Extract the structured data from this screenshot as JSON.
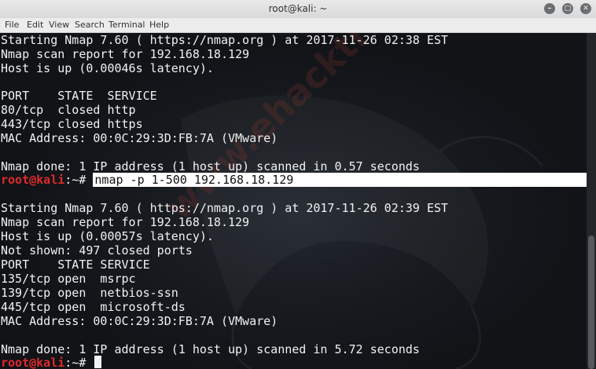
{
  "window": {
    "title": "root@kali: ~",
    "controls": [
      "minimize",
      "maximize",
      "close"
    ]
  },
  "menu": [
    "File",
    "Edit",
    "View",
    "Search",
    "Terminal",
    "Help"
  ],
  "watermark": "www.ehacktrick.in",
  "terminal": {
    "prompt_user": "root@kali",
    "prompt_rest": ":~#",
    "lines": [
      "Starting Nmap 7.60 ( https://nmap.org ) at 2017-11-26 02:38 EST",
      "Nmap scan report for 192.168.18.129",
      "Host is up (0.00046s latency).",
      "",
      "PORT    STATE  SERVICE",
      "80/tcp  closed http",
      "443/tcp closed https",
      "MAC Address: 00:0C:29:3D:FB:7A (VMware)",
      "",
      "Nmap done: 1 IP address (1 host up) scanned in 0.57 seconds"
    ],
    "command": "nmap -p 1-500 192.168.18.129",
    "lines2": [
      "",
      "Starting Nmap 7.60 ( https://nmap.org ) at 2017-11-26 02:39 EST",
      "Nmap scan report for 192.168.18.129",
      "Host is up (0.00057s latency).",
      "Not shown: 497 closed ports",
      "PORT    STATE SERVICE",
      "135/tcp open  msrpc",
      "139/tcp open  netbios-ssn",
      "445/tcp open  microsoft-ds",
      "MAC Address: 00:0C:29:3D:FB:7A (VMware)",
      "",
      "Nmap done: 1 IP address (1 host up) scanned in 5.72 seconds"
    ]
  }
}
